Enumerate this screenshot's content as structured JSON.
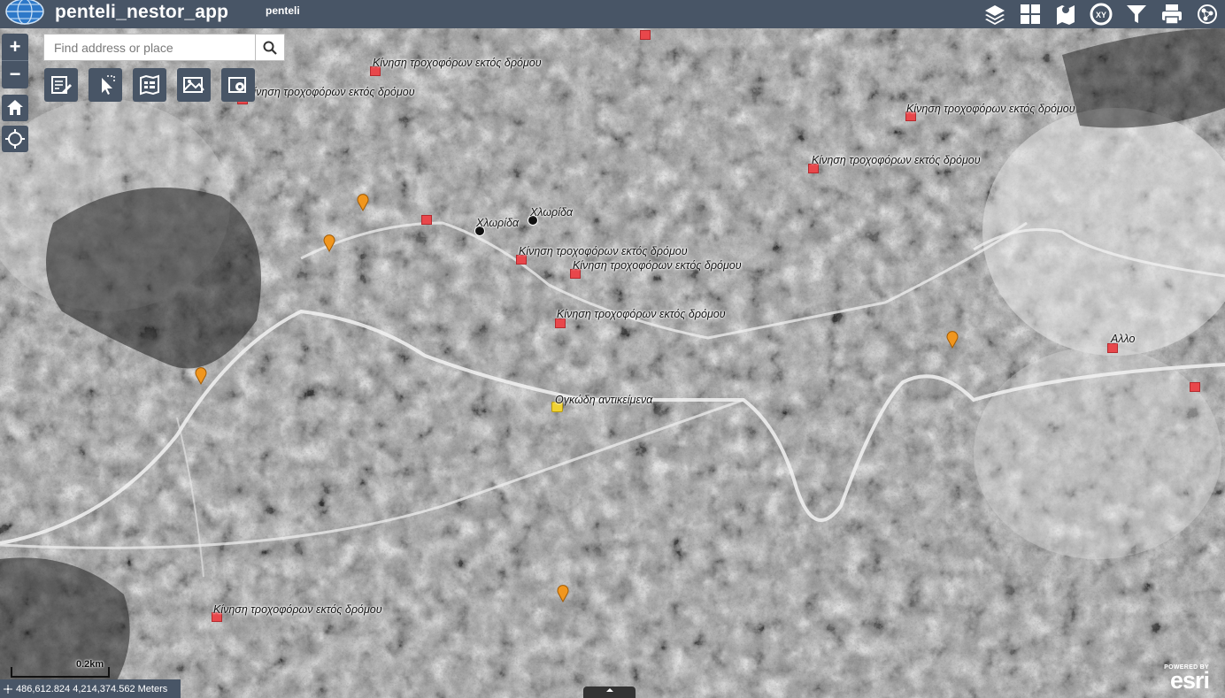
{
  "header": {
    "title": "penteli_nestor_app",
    "subtitle": "penteli",
    "icons": [
      "layers-icon",
      "basemap-gallery-icon",
      "print-map-icon",
      "coordinate-icon",
      "filter-icon",
      "printer-icon",
      "analysis-icon"
    ]
  },
  "search": {
    "placeholder": "Find address or place",
    "value": ""
  },
  "zoom": {
    "in": "+",
    "out": "−"
  },
  "widgets": [
    "edit-icon",
    "select-icon",
    "legend-icon",
    "basemap-icon",
    "settings-icon"
  ],
  "map_labels": {
    "l1": "Κίνηση τροχοφόρων εκτός δρόμου",
    "l2": "Κίνηση τροχοφόρων εκτός δρόμου",
    "l3": "Κίνηση τροχοφόρων εκτός δρόμου",
    "l4": "Κίνηση τροχοφόρων εκτός δρόμου",
    "l5": "Χλωρίδα",
    "l6": "Χλωρίδα",
    "l7": "Κίνηση τροχοφόρων εκτός δρόμου",
    "l8": "Κίνηση τροχοφόρων εκτός δρόμου",
    "l9": "Κίνηση τροχοφόρων εκτός δρόμου",
    "l10": "Αλλο",
    "l11": "Ογκώδη αντικείμενα",
    "l12": "Κίνηση τροχοφόρων εκτός δρόμου"
  },
  "scale": {
    "label": "0.2km"
  },
  "coordinates": {
    "text": "486,612.824 4,214,374.562 Meters"
  },
  "attribution": {
    "powered": "POWERED BY",
    "brand": "esri"
  },
  "colors": {
    "header": "#485566",
    "incident": "#e8474b",
    "pin": "#f0961e",
    "bulky": "#f0d232"
  }
}
